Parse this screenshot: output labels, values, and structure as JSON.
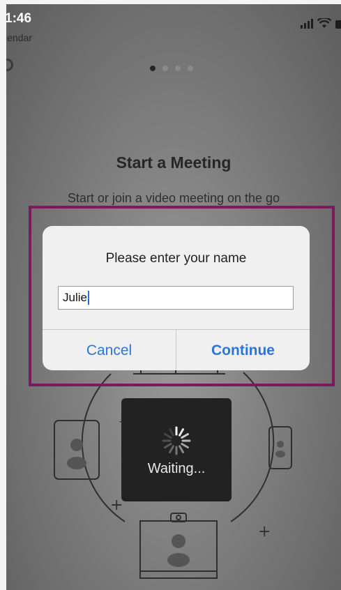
{
  "status_bar": {
    "time": "1:46",
    "back_label": "lendar"
  },
  "onboarding": {
    "title": "Start a Meeting",
    "subtitle": "Start or join a video meeting on the go"
  },
  "waiting": {
    "label": "Waiting..."
  },
  "dialog": {
    "prompt": "Please enter your name",
    "name_value": "Julie",
    "cancel_label": "Cancel",
    "continue_label": "Continue"
  },
  "colors": {
    "highlight": "#7d1a5b",
    "button": "#2b75d8"
  }
}
